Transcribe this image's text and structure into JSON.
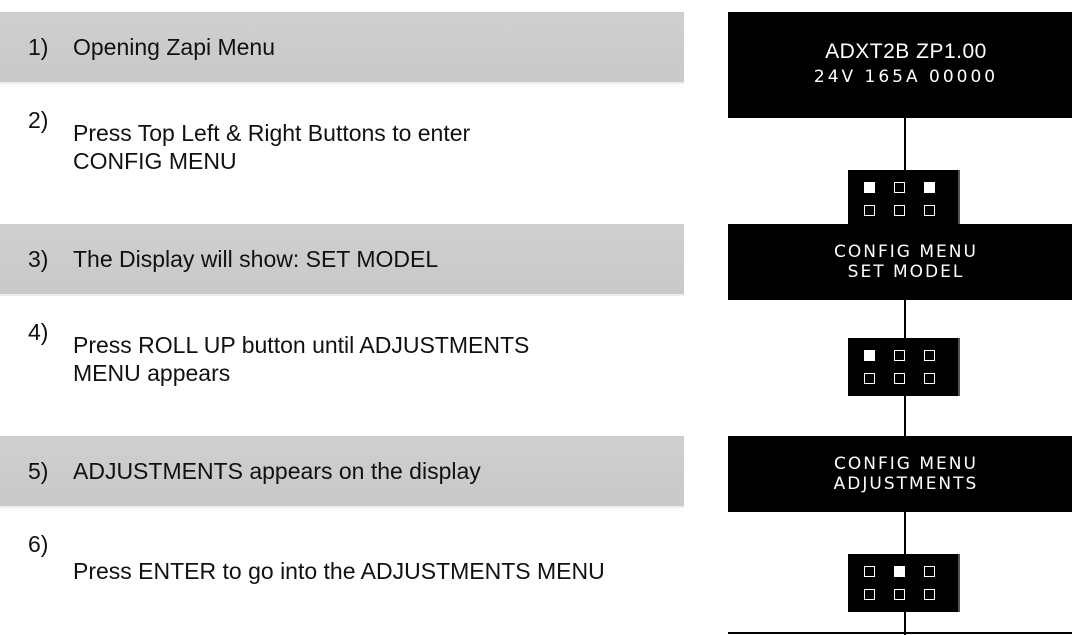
{
  "steps": [
    {
      "num": "1)",
      "text": "Opening Zapi Menu",
      "shaded": true
    },
    {
      "num": "2)",
      "text": "Press Top Left & Right Buttons to enter CONFIG MENU",
      "shaded": false
    },
    {
      "num": "3)",
      "text": "The Display will show: SET MODEL",
      "shaded": true
    },
    {
      "num": "4)",
      "text": "Press ROLL UP button until ADJUSTMENTS MENU appears",
      "shaded": false
    },
    {
      "num": "5)",
      "text": "ADJUSTMENTS appears on the display",
      "shaded": true
    },
    {
      "num": "6)",
      "text": "Press ENTER to go into the ADJUSTMENTS MENU",
      "shaded": false
    }
  ],
  "displays": [
    {
      "line1": "ADXT2B  ZP1.00",
      "line2": "24V 165A 00000"
    },
    {
      "line1": "CONFIG MENU",
      "line2": "SET MODEL"
    },
    {
      "line1": "CONFIG MENU",
      "line2": "ADJUSTMENTS"
    }
  ],
  "keypads": [
    {
      "pressed": [
        [
          true,
          false,
          true
        ],
        [
          false,
          false,
          false
        ]
      ]
    },
    {
      "pressed": [
        [
          true,
          false,
          false
        ],
        [
          false,
          false,
          false
        ]
      ]
    },
    {
      "pressed": [
        [
          false,
          true,
          false
        ],
        [
          false,
          false,
          false
        ]
      ]
    }
  ],
  "colors": {
    "step_shade": "#cbcbcb",
    "display_bg": "#000000",
    "display_text": "#ffffff"
  }
}
